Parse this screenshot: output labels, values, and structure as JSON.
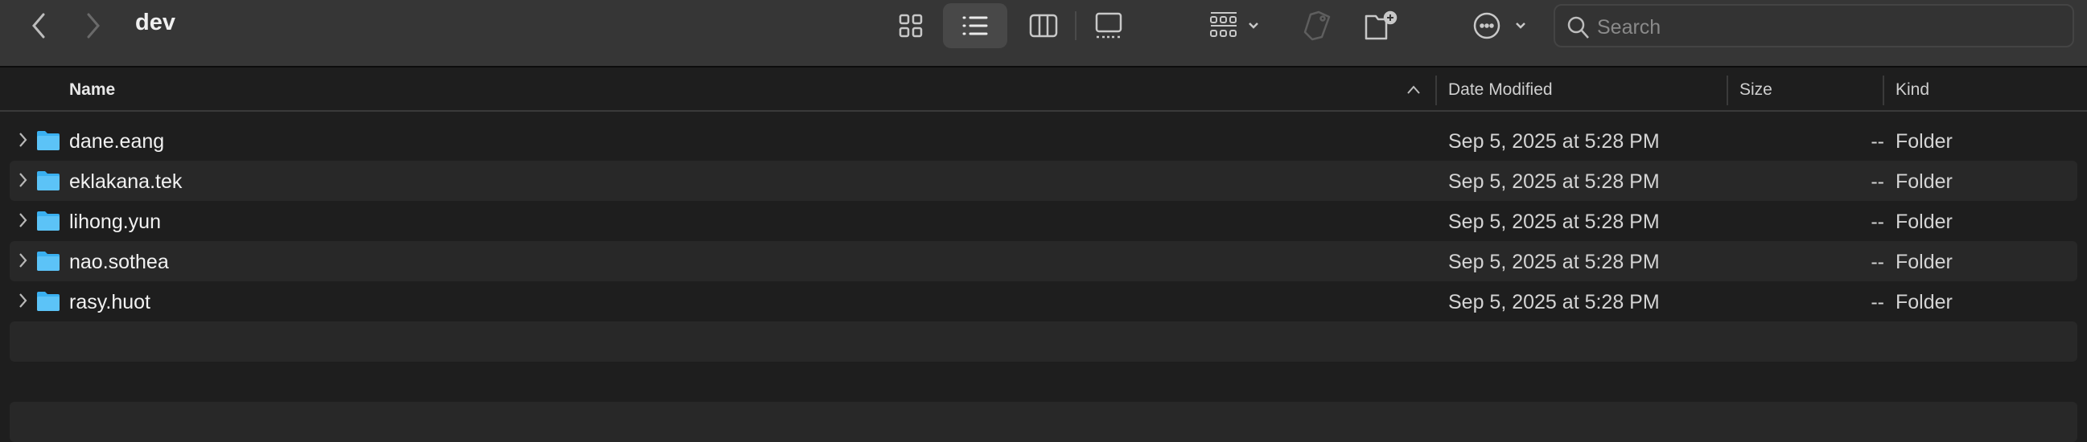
{
  "window": {
    "title": "dev"
  },
  "toolbar": {
    "back": "back-icon",
    "forward": "forward-icon",
    "views": [
      "icon-view",
      "list-view",
      "column-view",
      "gallery-view"
    ],
    "active_view": "list-view",
    "search_placeholder": "Search"
  },
  "columns": {
    "name": "Name",
    "date": "Date Modified",
    "size": "Size",
    "kind": "Kind",
    "sort": "ascending"
  },
  "rows": [
    {
      "name": "dane.eang",
      "date": "Sep 5, 2025 at 5:28 PM",
      "size": "--",
      "kind": "Folder"
    },
    {
      "name": "eklakana.tek",
      "date": "Sep 5, 2025 at 5:28 PM",
      "size": "--",
      "kind": "Folder"
    },
    {
      "name": "lihong.yun",
      "date": "Sep 5, 2025 at 5:28 PM",
      "size": "--",
      "kind": "Folder"
    },
    {
      "name": "nao.sothea",
      "date": "Sep 5, 2025 at 5:28 PM",
      "size": "--",
      "kind": "Folder"
    },
    {
      "name": "rasy.huot",
      "date": "Sep 5, 2025 at 5:28 PM",
      "size": "--",
      "kind": "Folder"
    }
  ],
  "colors": {
    "folder": "#3ab0f0",
    "toolbar": "#363636",
    "background": "#1e1e1e",
    "stripe": "#282828"
  }
}
